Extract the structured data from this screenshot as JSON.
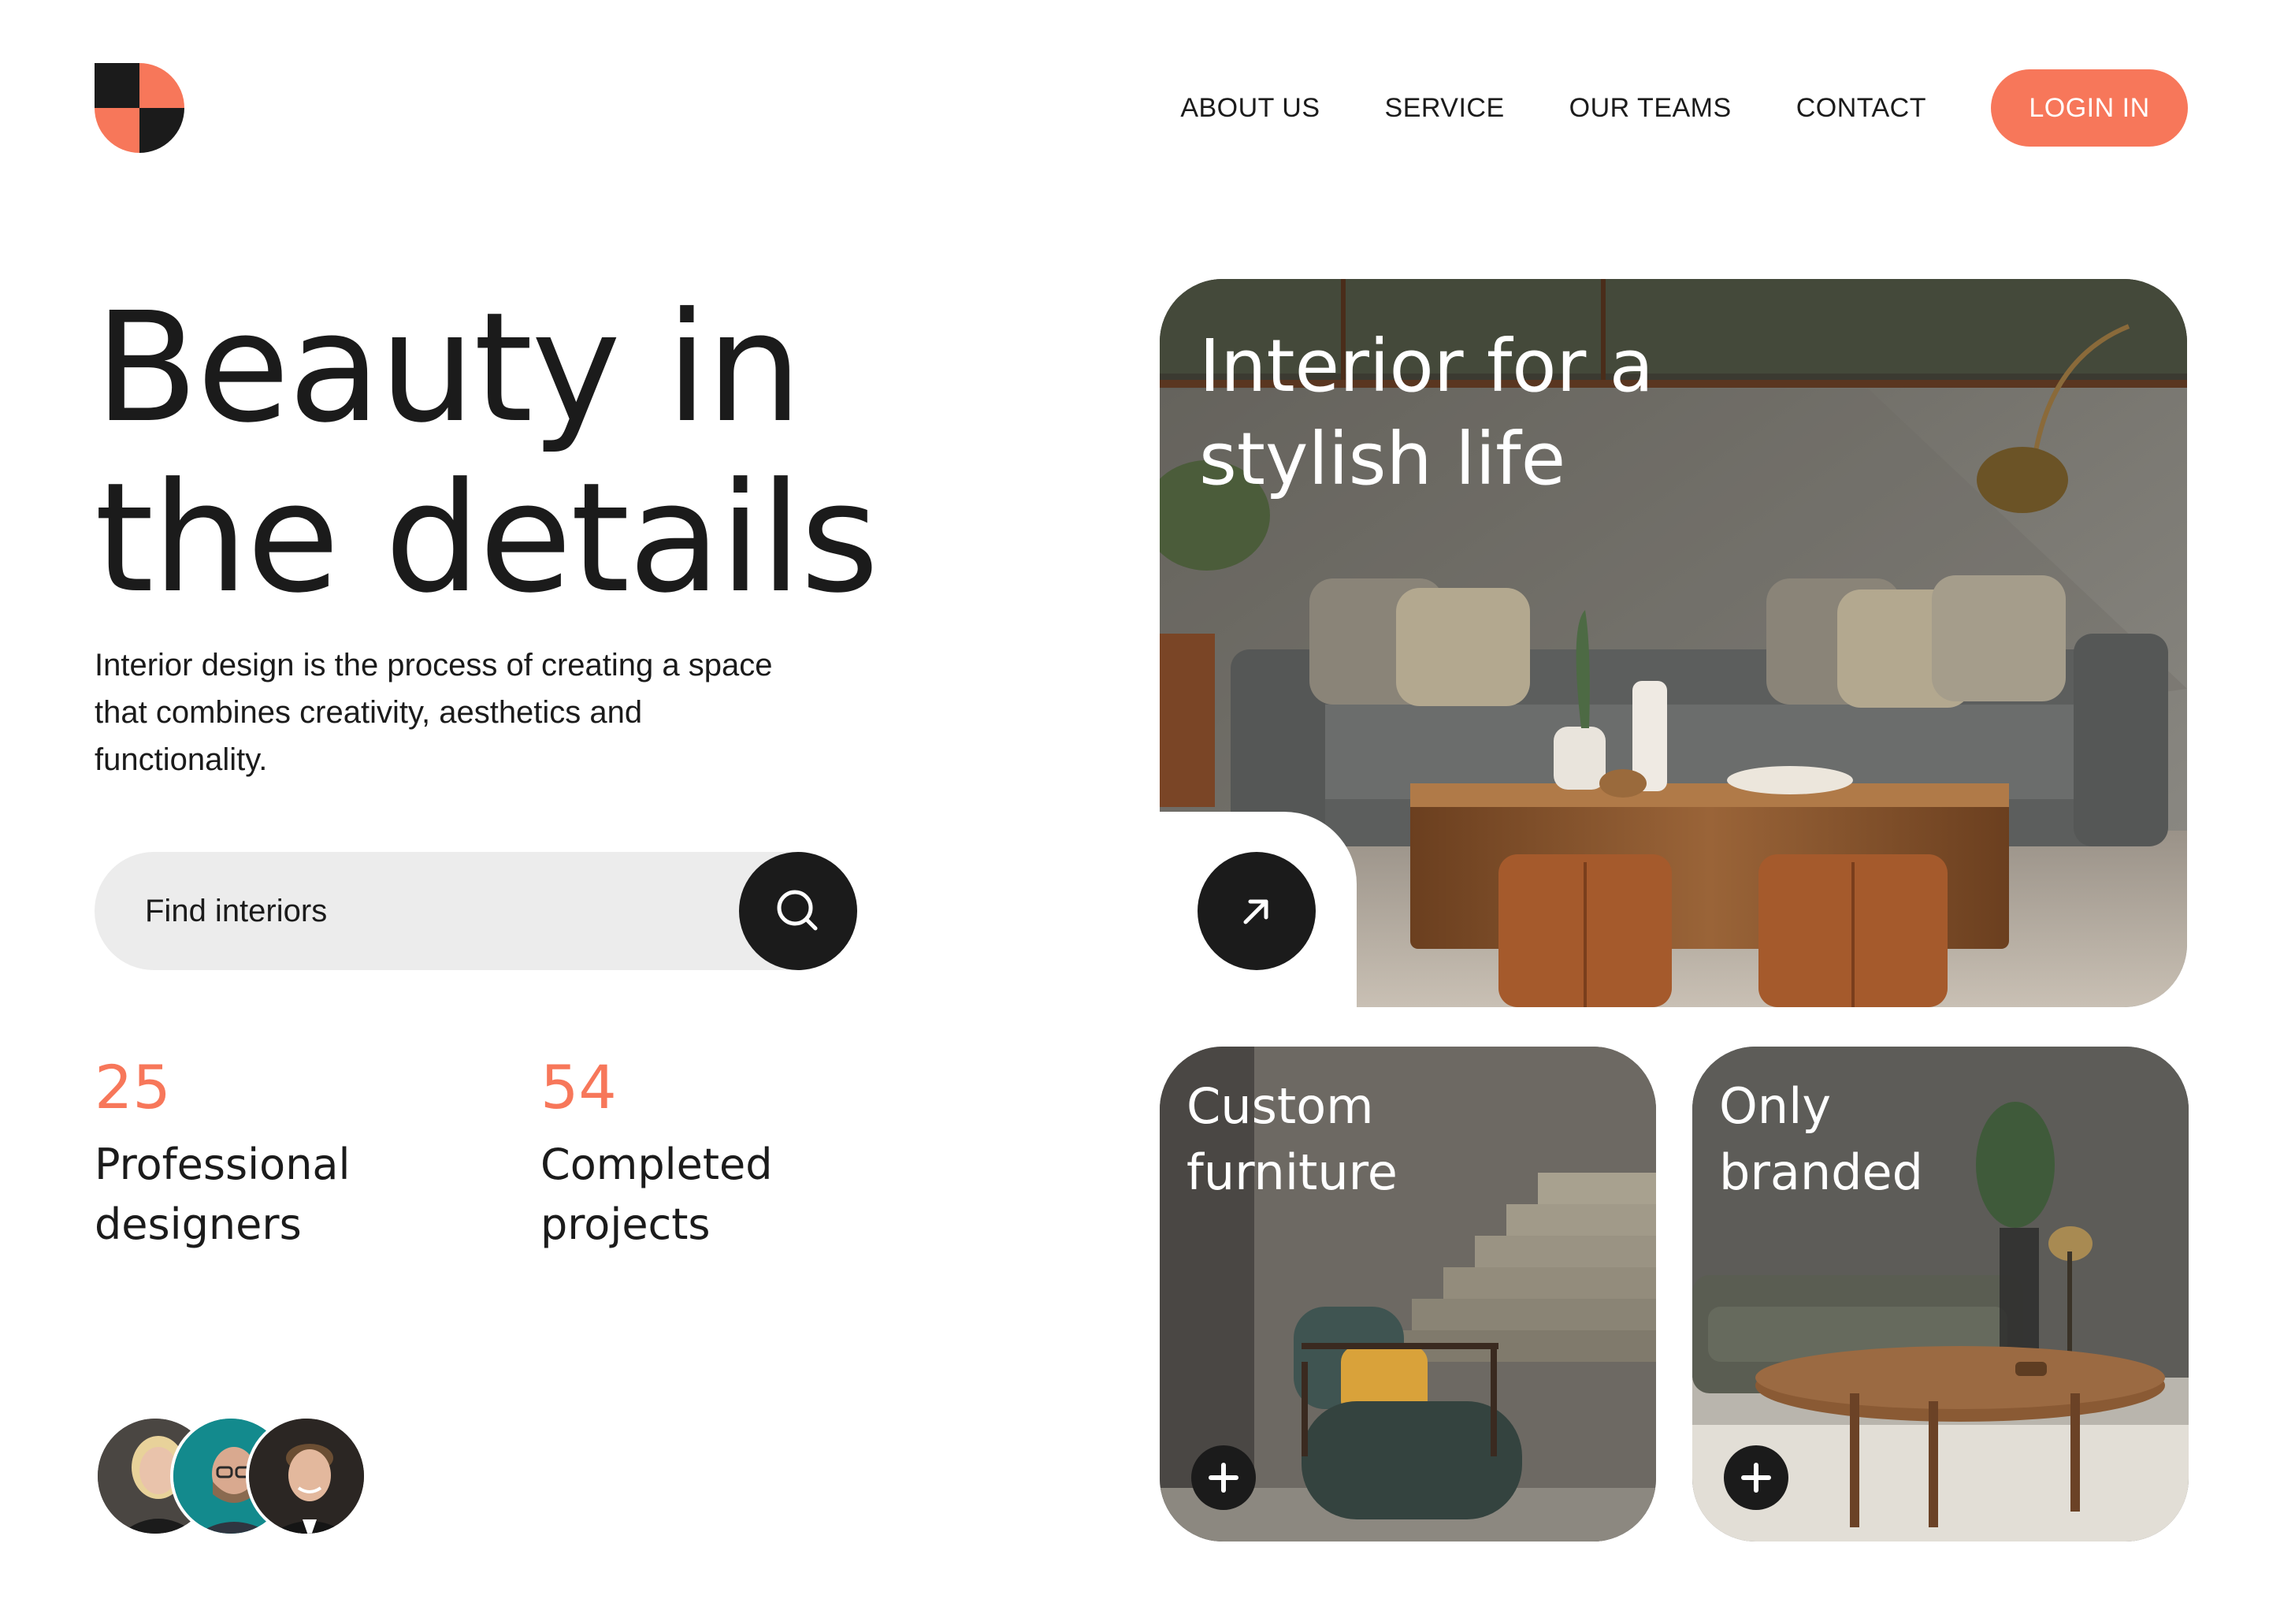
{
  "header": {
    "logo_icon": "quarter-circles-logo-icon",
    "nav": [
      {
        "label": "ABOUT US"
      },
      {
        "label": "SERVICE"
      },
      {
        "label": "OUR TEAMS"
      },
      {
        "label": "CONTACT"
      }
    ],
    "login_label": "LOGIN IN"
  },
  "hero": {
    "title_line1": "Beauty in",
    "title_line2": "the details",
    "description": "Interior design is the process of creating a space that combines creativity, aesthetics and functionality.",
    "search": {
      "placeholder": "Find interiors",
      "button_icon": "search-icon"
    },
    "stats": [
      {
        "number": "25",
        "label": "Professional designers"
      },
      {
        "number": "54",
        "label": "Completed projects"
      }
    ],
    "avatars": [
      "blonde-woman-avatar",
      "bearded-man-avatar",
      "smiling-man-avatar"
    ]
  },
  "cards": {
    "main": {
      "title": "Interior for a stylish life",
      "button_icon": "arrow-up-right-icon"
    },
    "custom": {
      "title": "Custom furniture",
      "button_icon": "plus-icon"
    },
    "branded": {
      "title": "Only branded",
      "button_icon": "plus-icon"
    }
  },
  "colors": {
    "accent": "#f7775a",
    "dark": "#1b1b1b",
    "search_bg": "#ececec"
  }
}
